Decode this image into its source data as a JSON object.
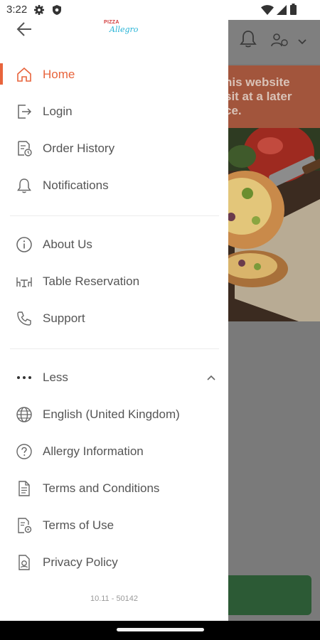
{
  "status_bar": {
    "time": "3:22",
    "left_icons": [
      "gear-icon",
      "shield-icon"
    ],
    "right_icons": [
      "wifi-icon",
      "signal-icon",
      "battery-icon"
    ]
  },
  "drawer": {
    "logo": {
      "top": "PIZZA",
      "script": "Allegro"
    },
    "primary_items": [
      {
        "label": "Home",
        "icon": "home-icon",
        "active": true
      },
      {
        "label": "Login",
        "icon": "login-icon"
      },
      {
        "label": "Order History",
        "icon": "order-history-icon"
      },
      {
        "label": "Notifications",
        "icon": "bell-icon"
      }
    ],
    "secondary_items": [
      {
        "label": "About Us",
        "icon": "info-icon"
      },
      {
        "label": "Table Reservation",
        "icon": "table-icon"
      },
      {
        "label": "Support",
        "icon": "phone-icon"
      }
    ],
    "less_label": "Less",
    "more_items": [
      {
        "label": "English (United Kingdom)",
        "icon": "globe-icon"
      },
      {
        "label": "Allergy Information",
        "icon": "question-icon"
      },
      {
        "label": "Terms and Conditions",
        "icon": "document-icon"
      },
      {
        "label": "Terms of Use",
        "icon": "document-gear-icon"
      },
      {
        "label": "Privacy Policy",
        "icon": "privacy-icon"
      }
    ],
    "version": "10.11 - 50142"
  },
  "background": {
    "banner_lines": [
      "his website",
      "sit at a later",
      "ce."
    ]
  },
  "colors": {
    "accent": "#e8643c",
    "text": "#555555",
    "overlay": "#7a7a7a",
    "banner": "#a2553c",
    "button": "#2c5a35"
  }
}
